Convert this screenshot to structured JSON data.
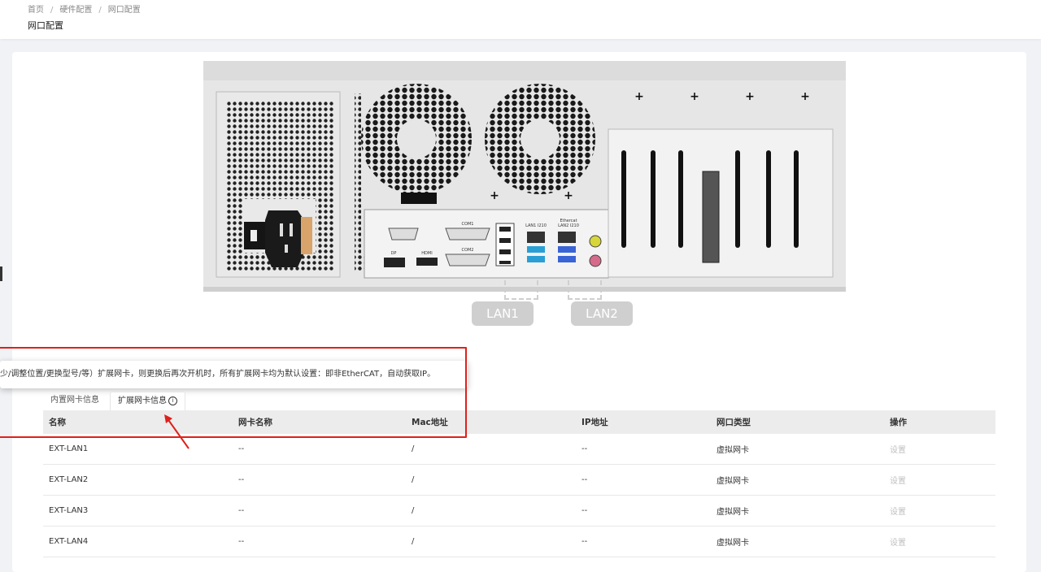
{
  "breadcrumb": {
    "home": "首页",
    "hardware": "硬件配置",
    "current": "网口配置"
  },
  "page_title": "网口配置",
  "lan_labels": [
    "LAN1",
    "LAN2"
  ],
  "tooltip": "少/调整位置/更换型号/等）扩展网卡，则更换后再次开机时，所有扩展网卡均为默认设置：即非EtherCAT，自动获取IP。",
  "tabs": {
    "builtin": "内置网卡信息",
    "extended": "扩展网卡信息"
  },
  "info_icon": "i",
  "table": {
    "headers": [
      "名称",
      "网卡名称",
      "Mac地址",
      "IP地址",
      "网口类型",
      "操作"
    ],
    "rows": [
      [
        "EXT-LAN1",
        "--",
        "/",
        "--",
        "虚拟网卡",
        "设置"
      ],
      [
        "EXT-LAN2",
        "--",
        "/",
        "--",
        "虚拟网卡",
        "设置"
      ],
      [
        "EXT-LAN3",
        "--",
        "/",
        "--",
        "虚拟网卡",
        "设置"
      ],
      [
        "EXT-LAN4",
        "--",
        "/",
        "--",
        "虚拟网卡",
        "设置"
      ]
    ]
  },
  "device_labels": {
    "com1": "COM1",
    "com2": "COM2",
    "hdmi": "HDMI",
    "dp": "DP",
    "lan_i210_1": "LAN1 I210",
    "ethercat": "Ethercat",
    "lan_i210_2": "LAN2 I210"
  },
  "colors": {
    "accent_red": "#e0201b",
    "header_bg": "#ececec",
    "disabled": "#c0c0c0"
  }
}
